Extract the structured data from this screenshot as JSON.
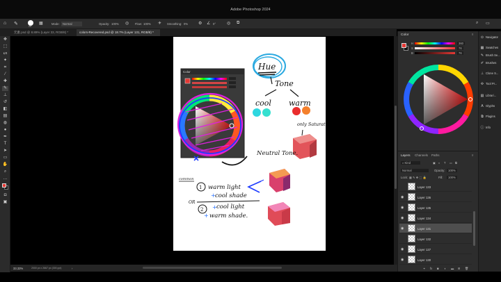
{
  "window": {
    "title": "Adobe Photoshop 2024"
  },
  "options_bar": {
    "brush_size": "26",
    "mode_label": "Mode:",
    "mode_value": "Normal",
    "opacity_label": "Opacity:",
    "opacity_value": "100%",
    "flow_label": "Flow:",
    "flow_value": "100%",
    "smoothing_label": "Smoothing:",
    "smoothing_value": "0%",
    "angle_value": "0°",
    "share_label": "Share"
  },
  "tabs": [
    {
      "label": "元素.psd @ 8.89% (Layer 33, RGB/8) *"
    },
    {
      "label": "colors-Recovered.psd @ 18.7% (Layer 131, RGB/8) *"
    }
  ],
  "status": {
    "zoom": "33.33%",
    "doc_info": "2000 px x 2667 px (300 ppi)"
  },
  "floating_color_panel": {
    "title": "Color"
  },
  "color_panel": {
    "title": "Color",
    "slider_values": [
      "360",
      "76",
      "76"
    ],
    "slider_labels": [
      "H",
      "S",
      "B"
    ]
  },
  "layers_panel": {
    "tabs": [
      "Layers",
      "Channels",
      "Paths"
    ],
    "kind_label": "Kind",
    "blend_mode": "Normal",
    "opacity_label": "Opacity:",
    "opacity_value": "100%",
    "lock_label": "Lock:",
    "fill_label": "Fill:",
    "fill_value": "100%",
    "layers": [
      {
        "name": "Layer 133",
        "visible": false,
        "selected": false
      },
      {
        "name": "Layer 136",
        "visible": true,
        "selected": false
      },
      {
        "name": "Layer 135",
        "visible": true,
        "selected": false
      },
      {
        "name": "Layer 134",
        "visible": true,
        "selected": false
      },
      {
        "name": "Layer 131",
        "visible": true,
        "selected": true
      },
      {
        "name": "Layer 132",
        "visible": false,
        "selected": false
      },
      {
        "name": "Layer 137",
        "visible": true,
        "selected": false
      },
      {
        "name": "Layer 130",
        "visible": true,
        "selected": false
      }
    ]
  },
  "dock": [
    {
      "label": "Navigator",
      "icon": "navigator-icon"
    },
    {
      "label": "Swatches",
      "icon": "swatches-icon"
    },
    {
      "label": "Brush Se...",
      "icon": "brush-settings-icon"
    },
    {
      "label": "Brushes",
      "icon": "brushes-icon"
    },
    {
      "label": "Clone S...",
      "icon": "clone-source-icon"
    },
    {
      "label": "Tool Pr...",
      "icon": "tool-presets-icon"
    },
    {
      "label": "Librari...",
      "icon": "libraries-icon"
    },
    {
      "label": "Glyphs",
      "icon": "glyphs-icon"
    },
    {
      "label": "Plugins",
      "icon": "plugins-icon"
    },
    {
      "label": "Info",
      "icon": "info-icon"
    }
  ],
  "artwork": {
    "hue": "Hue",
    "tone": "Tone",
    "cool": "cool",
    "warm": "warm",
    "only_saturation": "only Saturation",
    "neutral_tone": "Neutral Tone.",
    "common": "common",
    "line1": "warm light",
    "line2": "cool shade",
    "or": "OR",
    "line3": "cool light",
    "line4": "warm shade."
  },
  "colors": {
    "accent": "#1473e6",
    "foreground": "#e53935",
    "background": "#111111",
    "cool_swatch": "#2ed7e0",
    "warm_red": "#ea2d2d",
    "warm_orange": "#f4802c"
  }
}
